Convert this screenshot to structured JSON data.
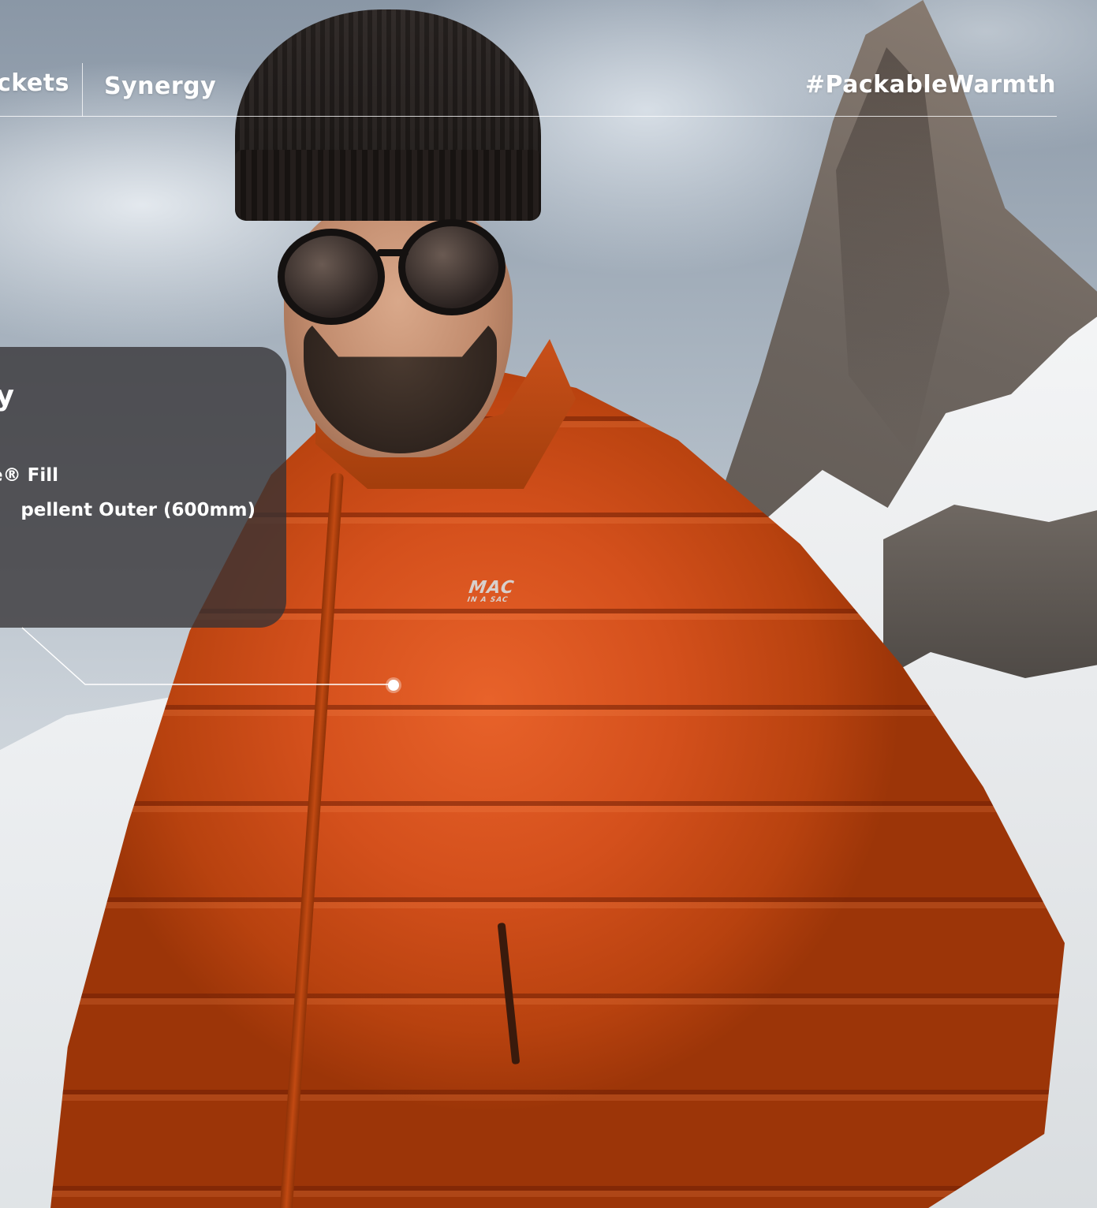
{
  "breadcrumb": {
    "previous_label": "ckets",
    "current_label": "Synergy"
  },
  "hashtag": "#PackableWarmth",
  "info_panel": {
    "title_fragment": "y",
    "features": [
      "e® Fill",
      "pellent Outer (600mm)"
    ]
  },
  "brand_mark": {
    "line1": "MAC",
    "line2": "IN A SAC"
  },
  "colors": {
    "jacket": "#d4501c",
    "panel": "#343234",
    "text": "#ffffff"
  },
  "icons": {
    "hotspot": "hotspot-dot-icon"
  }
}
